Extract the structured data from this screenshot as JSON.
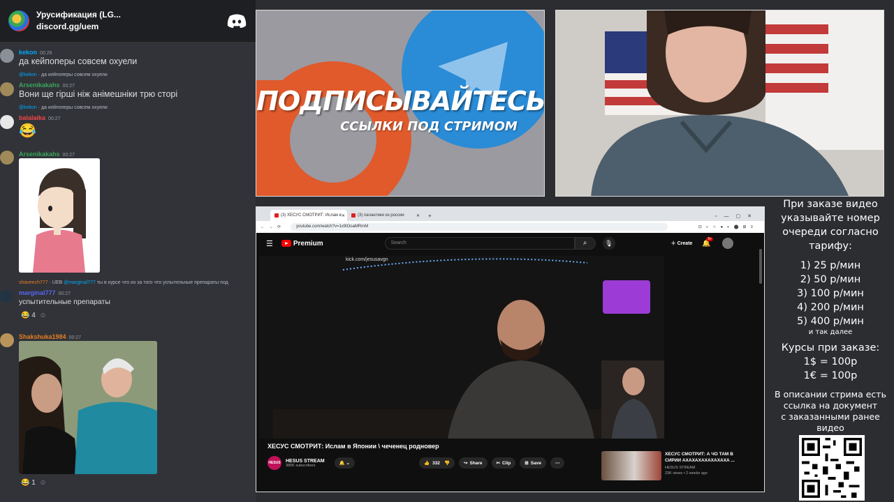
{
  "discord": {
    "server_name": "Урусификация (LG...",
    "server_link": "discord.gg/uem",
    "messages": [
      {
        "user": "kekon",
        "user_color": "#00a8fc",
        "time": "00:26",
        "text": "да кейпоперы совсем охуели"
      },
      {
        "reply_user": "@kekon",
        "reply_text": "да кейпоперы совсем охуели",
        "user": "Arsenikakahs",
        "user_color": "#3ba55c",
        "time": "00:27",
        "text": "Вони ще гірші ніж анімешніки трю сторі"
      },
      {
        "reply_user": "@kekon",
        "reply_text": "да кейпоперы совсем охуели",
        "user": "balalaika",
        "user_color": "#f04747",
        "time": "00:27",
        "text": "😂"
      },
      {
        "user": "Arsenikakahs",
        "user_color": "#3ba55c",
        "time": "00:27"
      },
      {
        "reply_user": "UEB",
        "reply_mention": "@marginal777",
        "reply_text": "ты в курсе что из за того что успытельные препараты под",
        "user": "marginal777",
        "user_color": "#5865f2",
        "time": "00:27",
        "text": "успытительные препараты",
        "reaction_count": "4"
      },
      {
        "user": "Shakshuka1984",
        "user_color": "#e67e22",
        "time": "00:27",
        "reaction_count": "1"
      }
    ]
  },
  "promo": {
    "title": "ПОДПИСЫВАЙТЕСЬ",
    "subtitle": "ССЫЛКИ ПОД СТРИМОМ"
  },
  "browser": {
    "tabs": [
      "(3) ХЕСУС СМОТРИТ: Ислам в",
      "(3) палантики из россии"
    ],
    "url": "youtube.com/watch?v=1x9lOoaMRmM",
    "search_placeholder": "Search",
    "create_label": "Create",
    "notif_count": "9+",
    "video_overlay": "kick.com/jesusavgn",
    "video_title": "ХЕСУС СМОТРИТ: Ислам в Японии \\ чеченец родновер",
    "channel_name": "HESUS STREAM",
    "channel_subs": "385K subscribers",
    "channel_avatar_text": "HESUS",
    "likes": "332",
    "share_label": "Share",
    "clip_label": "Clip",
    "save_label": "Save",
    "side_title": "ХЕСУС СМОТРИТ: А ЧО ТАМ В СИРИИ АХАХАХАХАХАХАХА ...",
    "side_channel": "HESUS STREAM",
    "side_meta": "23K views • 2 weeks ago"
  },
  "prices": {
    "intro": [
      "При заказе видео",
      "указывайте номер",
      "очереди согласно",
      "тарифу:"
    ],
    "tiers": [
      "1) 25 р/мин",
      "2) 50 р/мин",
      "3) 100 р/мин",
      "4) 200 р/мин",
      "5) 400 р/мин"
    ],
    "more": "и так далее",
    "rates_title": "Курсы при заказе:",
    "rates": [
      "1$ = 100р",
      "1€ = 100р"
    ],
    "footer": [
      "В описании стрима есть",
      "ссылка на документ",
      "с заказанными ранее",
      "видео"
    ]
  }
}
